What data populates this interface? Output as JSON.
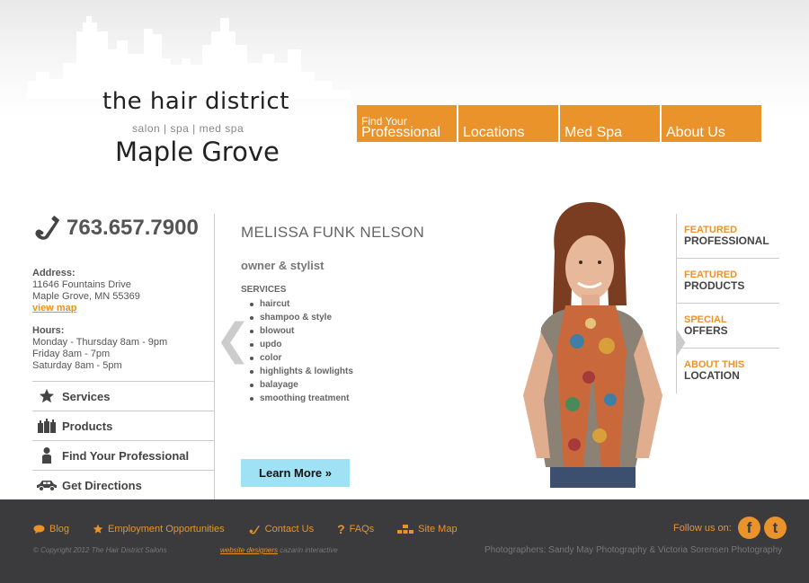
{
  "header": {
    "logo_title": "the hair district",
    "logo_subtitle": "salon  |  spa  |  med spa",
    "logo_city": "Maple Grove",
    "nav": [
      {
        "small": "Find Your",
        "label": "Professional"
      },
      {
        "small": "",
        "label": "Locations"
      },
      {
        "small": "",
        "label": "Med Spa"
      },
      {
        "small": "",
        "label": "About Us"
      }
    ]
  },
  "contact": {
    "phone": "763.657.7900",
    "address_label": "Address:",
    "address_line1": "11646 Fountains Drive",
    "address_line2": "Maple Grove, MN 55369",
    "view_map": "view map",
    "hours_label": "Hours:",
    "hours": [
      "Monday - Thursday 8am - 9pm",
      "Friday 8am - 7pm",
      "Saturday 8am - 5pm"
    ]
  },
  "left_menu": [
    {
      "label": "Services",
      "icon": "star-icon"
    },
    {
      "label": "Products",
      "icon": "bottles-icon"
    },
    {
      "label": "Find Your Professional",
      "icon": "person-icon"
    },
    {
      "label": "Get Directions",
      "icon": "car-icon"
    }
  ],
  "profile": {
    "name": "MELISSA FUNK NELSON",
    "role": "owner & stylist",
    "services_label": "SERVICES",
    "services": [
      "haircut",
      "shampoo & style",
      "blowout",
      "updo",
      "color",
      "highlights & lowlights",
      "balayage",
      "smoothing treatment"
    ],
    "learn_more": "Learn More »",
    "prev_arrow": "❮",
    "next_arrow": "❯"
  },
  "right_menu": [
    {
      "top": "FEATURED",
      "bottom": "PROFESSIONAL"
    },
    {
      "top": "FEATURED",
      "bottom": "PRODUCTS"
    },
    {
      "top": "SPECIAL",
      "bottom": "OFFERS"
    },
    {
      "top": "ABOUT THIS",
      "bottom": "LOCATION"
    }
  ],
  "footer": {
    "links": [
      {
        "label": "Blog",
        "icon": "chat-icon"
      },
      {
        "label": "Employment Opportunities",
        "icon": "star-icon"
      },
      {
        "label": "Contact Us",
        "icon": "phone-icon"
      },
      {
        "label": "FAQs",
        "icon": "question-icon"
      },
      {
        "label": "Site Map",
        "icon": "sitemap-icon"
      }
    ],
    "follow": "Follow us on:",
    "facebook": "f",
    "twitter": "t",
    "copyright": "© Copyright 2012 The Hair District Salons",
    "designers_link": "website designers",
    "designers_name": " cazarin interactive",
    "photographers": "Photographers: Sandy May Photography & Victoria Sorensen Photography"
  },
  "colors": {
    "accent": "#ea932b",
    "footer_bg": "#3b3b3d",
    "button": "#9fe1f5"
  }
}
